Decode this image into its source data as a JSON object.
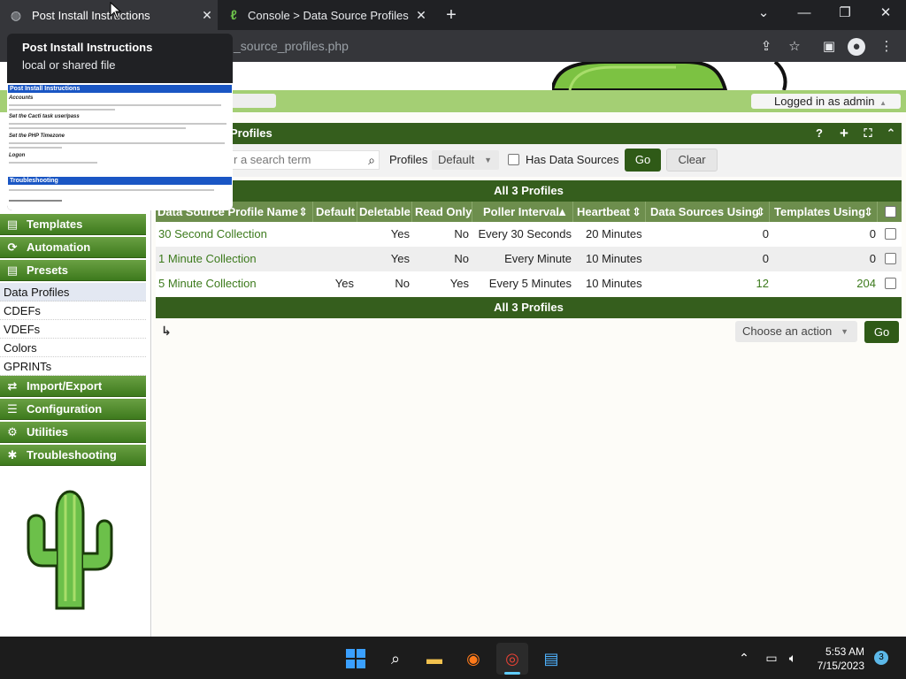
{
  "browser": {
    "tabs": [
      {
        "title": "Post Install Instructions",
        "active": true
      },
      {
        "title": "Console > Data Source Profiles",
        "active": false
      }
    ],
    "url": "_source_profiles.php",
    "window_controls": {
      "minimize": "—",
      "restore": "❐",
      "close": "✕",
      "tablist": "⌄"
    }
  },
  "tooltip": {
    "title": "Post Install Instructions",
    "subtitle": "local or shared file",
    "preview": {
      "header": "Post Install Instructions",
      "sections": [
        "Accounts",
        "Set the Cacti task user/pass",
        "Set the PHP Timezone",
        "Logon"
      ],
      "troubleshooting": "Troubleshooting"
    }
  },
  "header": {
    "logged_in": "Logged in as admin"
  },
  "sidebar": {
    "menus_top": [
      {
        "label": "Templates",
        "icon": "templates-icon",
        "glyph": "▤"
      },
      {
        "label": "Automation",
        "icon": "automation-icon",
        "glyph": "⟳"
      },
      {
        "label": "Presets",
        "icon": "presets-icon",
        "glyph": "▤"
      }
    ],
    "preset_items": [
      {
        "label": "Data Profiles",
        "active": true
      },
      {
        "label": "CDEFs",
        "active": false
      },
      {
        "label": "VDEFs",
        "active": false
      },
      {
        "label": "Colors",
        "active": false
      },
      {
        "label": "GPRINTs",
        "active": false
      }
    ],
    "menus_bottom": [
      {
        "label": "Import/Export",
        "icon": "import-export-icon",
        "glyph": "⇄"
      },
      {
        "label": "Configuration",
        "icon": "configuration-icon",
        "glyph": "☰"
      },
      {
        "label": "Utilities",
        "icon": "utilities-icon",
        "glyph": "⚙"
      },
      {
        "label": "Troubleshooting",
        "icon": "troubleshooting-icon",
        "glyph": "✱"
      }
    ]
  },
  "panel": {
    "title": "Profiles",
    "search_placeholder": "r a search term",
    "profiles_label": "Profiles",
    "profiles_value": "Default",
    "has_ds_label": "Has Data Sources",
    "go_label": "Go",
    "clear_label": "Clear",
    "count_label": "All 3 Profiles"
  },
  "table": {
    "columns": [
      "Data Source Profile Name",
      "Default",
      "Deletable",
      "Read Only",
      "Poller Interval",
      "Heartbeat",
      "Data Sources Using",
      "Templates Using"
    ],
    "rows": [
      {
        "name": "30 Second Collection",
        "default": "",
        "deletable": "Yes",
        "readonly": "No",
        "poller": "Every 30 Seconds",
        "heartbeat": "20 Minutes",
        "ds": "0",
        "templates": "0"
      },
      {
        "name": "1 Minute Collection",
        "default": "",
        "deletable": "Yes",
        "readonly": "No",
        "poller": "Every Minute",
        "heartbeat": "10 Minutes",
        "ds": "0",
        "templates": "0"
      },
      {
        "name": "5 Minute Collection",
        "default": "Yes",
        "deletable": "No",
        "readonly": "Yes",
        "poller": "Every 5 Minutes",
        "heartbeat": "10 Minutes",
        "ds": "12",
        "templates": "204"
      }
    ]
  },
  "actions": {
    "placeholder": "Choose an action",
    "go_label": "Go"
  },
  "taskbar": {
    "time": "5:53 AM",
    "date": "7/15/2023",
    "notifications": "3"
  },
  "colors": {
    "accent_green": "#355e1d",
    "link_green": "#3c7a1c",
    "header_green": "#a4cf74"
  }
}
